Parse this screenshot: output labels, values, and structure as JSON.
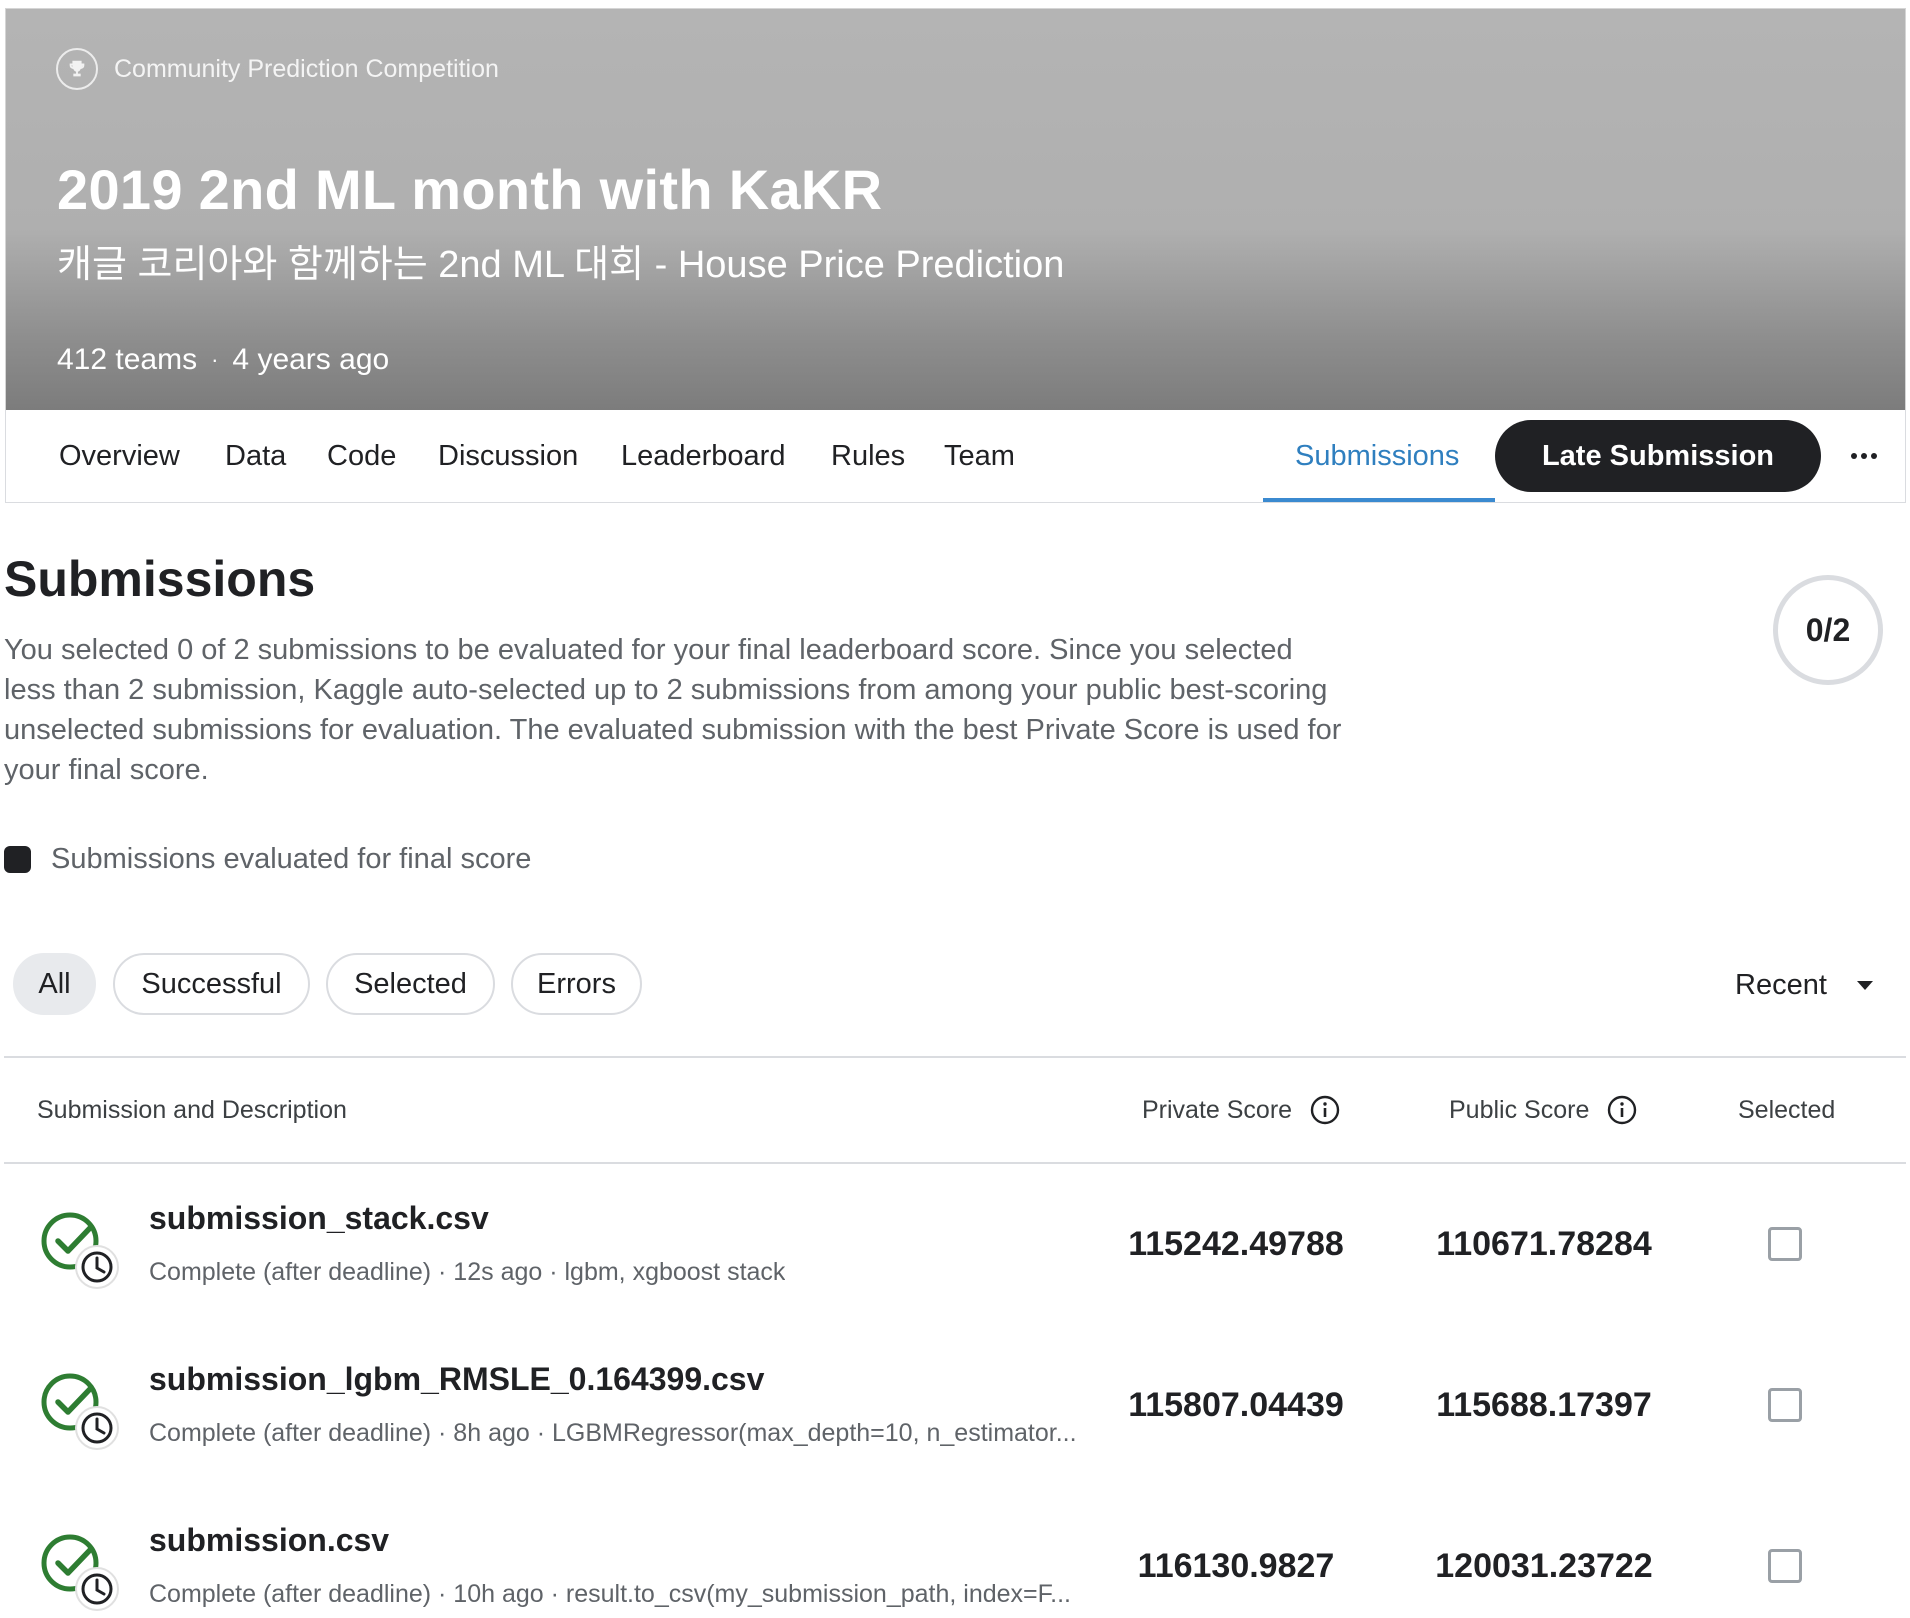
{
  "banner": {
    "type_label": "Community Prediction Competition",
    "title": "2019 2nd ML month with KaKR",
    "subtitle": "캐글 코리아와 함께하는 2nd ML 대회 - House Price Prediction",
    "teams": "412 teams",
    "separator": "·",
    "age": "4 years ago",
    "icon": "trophy-icon"
  },
  "tabs": [
    {
      "label": "Overview"
    },
    {
      "label": "Data"
    },
    {
      "label": "Code"
    },
    {
      "label": "Discussion"
    },
    {
      "label": "Leaderboard"
    },
    {
      "label": "Rules"
    },
    {
      "label": "Team"
    },
    {
      "label": "Submissions",
      "active": true
    }
  ],
  "actions": {
    "late_submission_label": "Late Submission",
    "more_label": "···"
  },
  "submissions": {
    "title": "Submissions",
    "description": "You selected 0 of 2 submissions to be evaluated for your final leaderboard score. Since you selected less than 2 submission, Kaggle auto-selected up to 2 submissions from among your public best-scoring unselected submissions for evaluation. The evaluated submission with the best Private Score is used for your final score.",
    "counter": "0/2",
    "legend_label": "Submissions evaluated for final score"
  },
  "filters": {
    "chips": [
      {
        "label": "All",
        "active": true
      },
      {
        "label": "Successful"
      },
      {
        "label": "Selected"
      },
      {
        "label": "Errors"
      }
    ],
    "sort_label": "Recent"
  },
  "table": {
    "headers": {
      "submission": "Submission and Description",
      "private": "Private Score",
      "public": "Public Score",
      "selected": "Selected"
    },
    "rows": [
      {
        "name": "submission_stack.csv",
        "meta": "Complete (after deadline) · 12s ago · lgbm, xgboost stack",
        "private_score": "115242.49788",
        "public_score": "110671.78284",
        "selected": false
      },
      {
        "name": "submission_lgbm_RMSLE_0.164399.csv",
        "meta": "Complete (after deadline) · 8h ago · LGBMRegressor(max_depth=10, n_estimator...",
        "private_score": "115807.04439",
        "public_score": "115688.17397",
        "selected": false
      },
      {
        "name": "submission.csv",
        "meta": "Complete (after deadline) · 10h ago · result.to_csv(my_submission_path, index=F...",
        "private_score": "116130.9827",
        "public_score": "120031.23722",
        "selected": false
      }
    ]
  },
  "colors": {
    "accent": "#2f7fbf",
    "success_green": "#2e7d32",
    "dark": "#202124"
  }
}
